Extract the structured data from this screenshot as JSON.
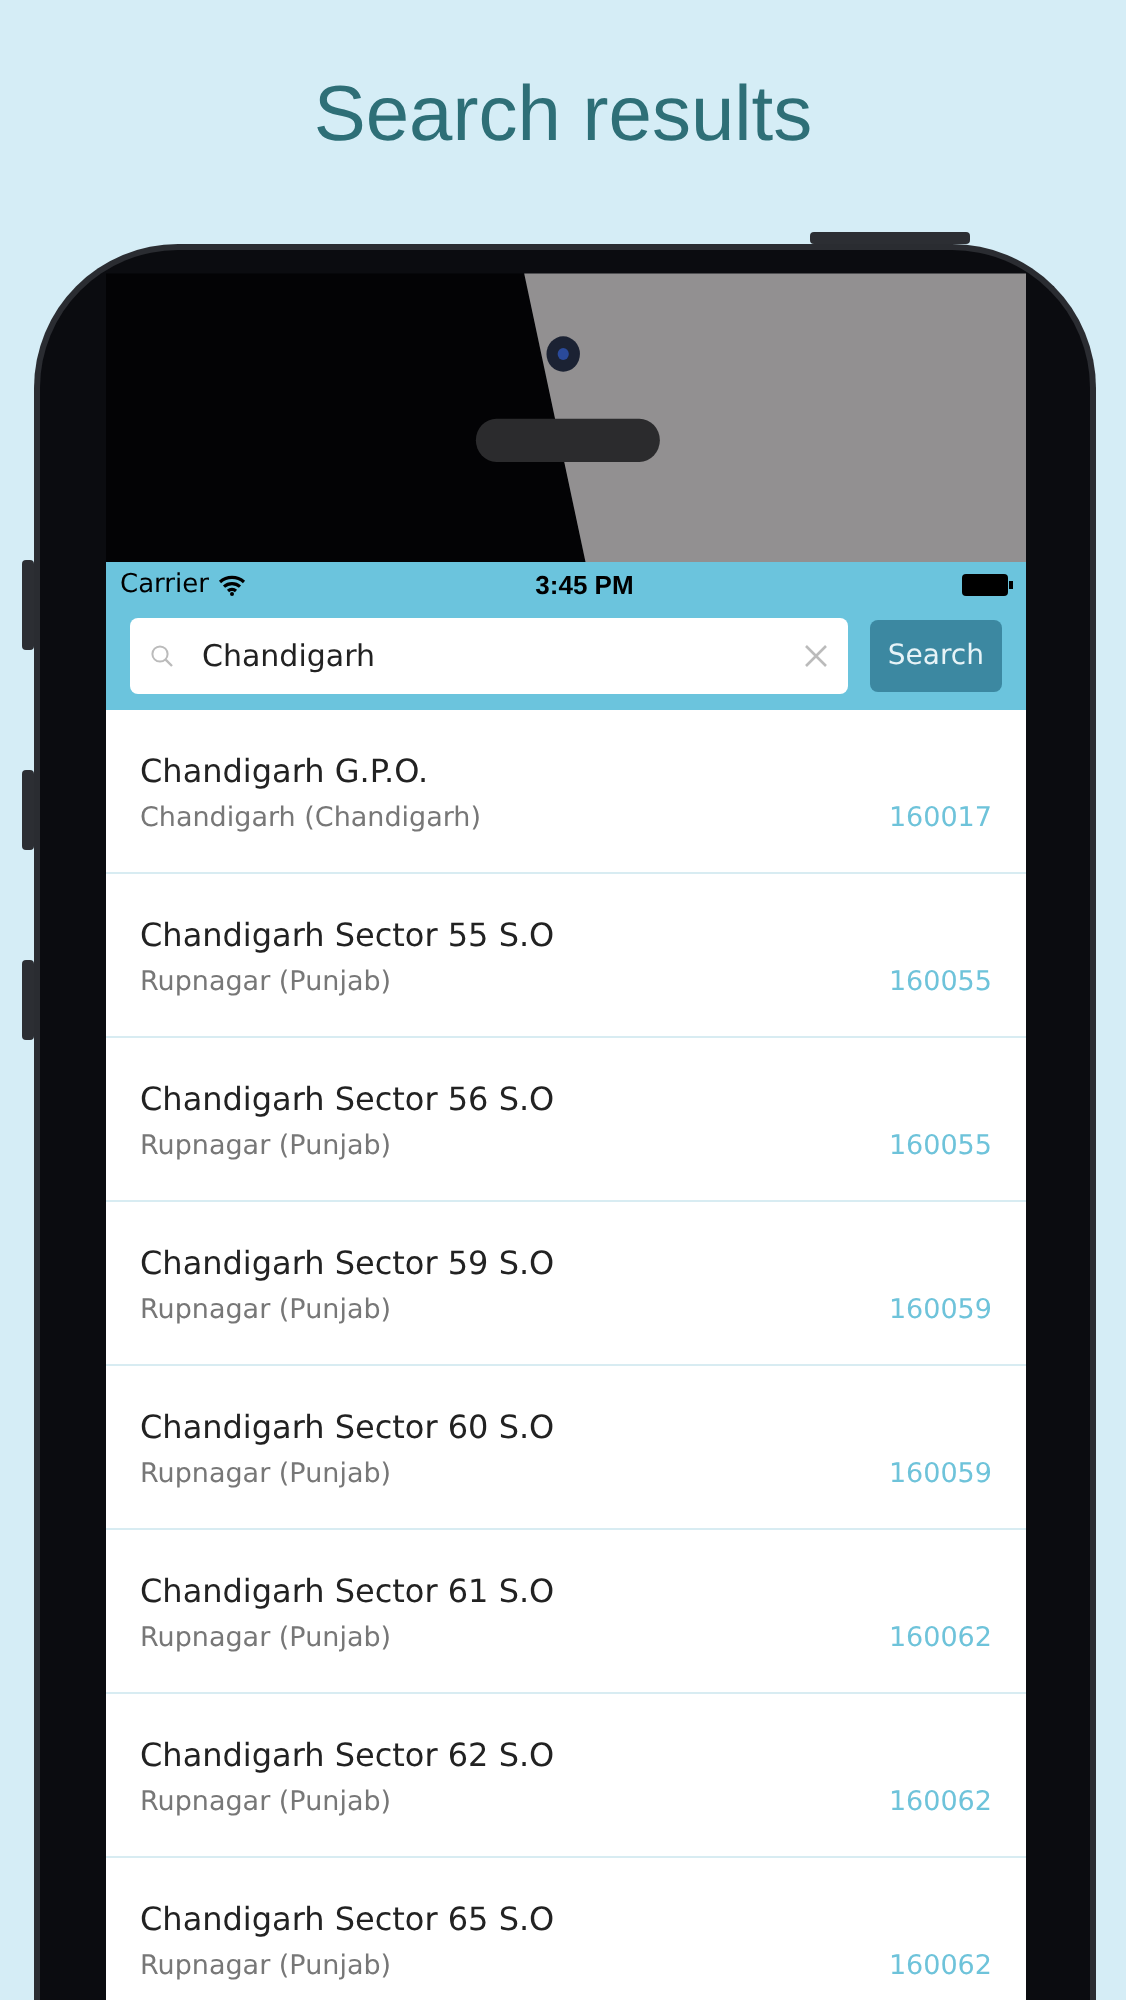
{
  "heading": "Search results",
  "status_bar": {
    "carrier": "Carrier",
    "time": "3:45 PM"
  },
  "search": {
    "value": "Chandigarh",
    "button": "Search"
  },
  "results": [
    {
      "name": "Chandigarh G.P.O.",
      "district": "Chandigarh (Chandigarh)",
      "pincode": "160017"
    },
    {
      "name": "Chandigarh Sector 55 S.O",
      "district": "Rupnagar (Punjab)",
      "pincode": "160055"
    },
    {
      "name": "Chandigarh Sector 56 S.O",
      "district": "Rupnagar (Punjab)",
      "pincode": "160055"
    },
    {
      "name": "Chandigarh Sector 59 S.O",
      "district": "Rupnagar (Punjab)",
      "pincode": "160059"
    },
    {
      "name": "Chandigarh Sector 60 S.O",
      "district": "Rupnagar (Punjab)",
      "pincode": "160059"
    },
    {
      "name": "Chandigarh Sector 61 S.O",
      "district": "Rupnagar (Punjab)",
      "pincode": "160062"
    },
    {
      "name": "Chandigarh Sector 62 S.O",
      "district": "Rupnagar (Punjab)",
      "pincode": "160062"
    },
    {
      "name": "Chandigarh Sector 65 S.O",
      "district": "Rupnagar (Punjab)",
      "pincode": "160062"
    }
  ]
}
